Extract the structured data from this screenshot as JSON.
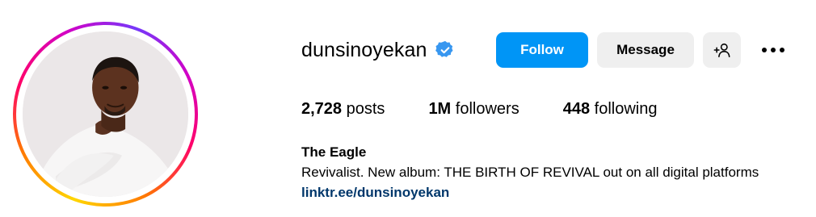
{
  "profile": {
    "username": "dunsinoyekan",
    "verified": true,
    "verified_color": "#3897f0"
  },
  "actions": {
    "follow_label": "Follow",
    "message_label": "Message",
    "add_user_icon": "add-person-icon",
    "more_icon": "more-horizontal-icon"
  },
  "stats": {
    "posts_count": "2,728",
    "posts_label": "posts",
    "followers_count": "1M",
    "followers_label": "followers",
    "following_count": "448",
    "following_label": "following"
  },
  "bio": {
    "name": "The Eagle",
    "text": "Revivalist. New album: THE BIRTH OF REVIVAL out on all digital platforms",
    "link": "linktr.ee/dunsinoyekan"
  },
  "colors": {
    "accent": "#0095f6",
    "secondary_button": "#efefef",
    "link": "#00376b"
  }
}
